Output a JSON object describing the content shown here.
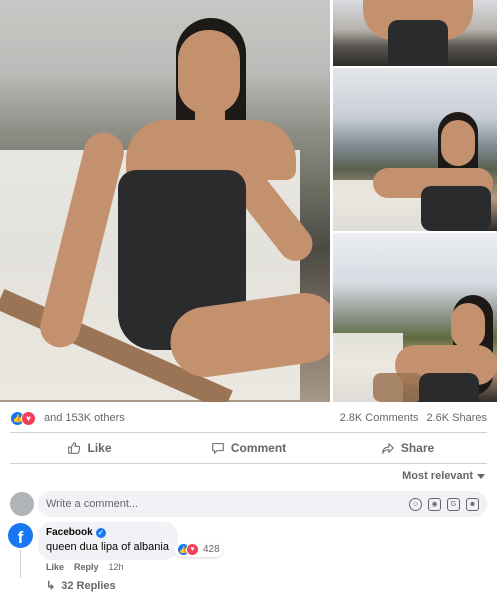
{
  "reactions": {
    "summary": "and 153K others",
    "comments_count": "2.8K Comments",
    "shares_count": "2.6K Shares"
  },
  "actions": {
    "like": "Like",
    "comment": "Comment",
    "share": "Share"
  },
  "sort": {
    "label": "Most relevant"
  },
  "composer": {
    "placeholder": "Write a comment..."
  },
  "comment": {
    "author": "Facebook",
    "text": "queen dua lipa of albania",
    "reaction_count": "428",
    "like_label": "Like",
    "reply_label": "Reply",
    "time": "12h",
    "replies_label": "32 Replies"
  },
  "colors": {
    "accent": "#1877f2",
    "love": "#f33e58",
    "muted_text": "#65676b",
    "input_bg": "#f0f2f5"
  }
}
